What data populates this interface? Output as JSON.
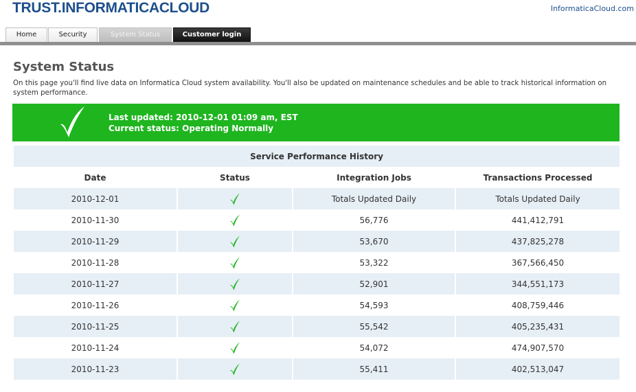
{
  "header": {
    "logo_text": "TRUST.INFORMATICACLOUD",
    "site_link": "InformaticaCloud.com"
  },
  "tabs": [
    {
      "label": "Home"
    },
    {
      "label": "Security"
    },
    {
      "label": "System Status"
    },
    {
      "label": "Customer login"
    }
  ],
  "page": {
    "title": "System Status",
    "intro": "On this page you'll find live data on Informatica Cloud system availability. You'll also be updated on maintenance schedules and be able to track historical information on system performance."
  },
  "banner": {
    "last_updated": "Last updated: 2010-12-01 01:09 am, EST",
    "current_status": "Current status: Operating Normally",
    "icon": "check-icon",
    "color": "#1fb51f"
  },
  "history": {
    "caption": "Service Performance History",
    "columns": [
      "Date",
      "Status",
      "Integration Jobs",
      "Transactions Processed"
    ],
    "rows": [
      {
        "date": "2010-12-01",
        "status": "check-icon",
        "jobs": "Totals Updated Daily",
        "transactions": "Totals Updated Daily"
      },
      {
        "date": "2010-11-30",
        "status": "check-icon",
        "jobs": "56,776",
        "transactions": "441,412,791"
      },
      {
        "date": "2010-11-29",
        "status": "check-icon",
        "jobs": "53,670",
        "transactions": "437,825,278"
      },
      {
        "date": "2010-11-28",
        "status": "check-icon",
        "jobs": "53,322",
        "transactions": "367,566,450"
      },
      {
        "date": "2010-11-27",
        "status": "check-icon",
        "jobs": "52,901",
        "transactions": "344,551,173"
      },
      {
        "date": "2010-11-26",
        "status": "check-icon",
        "jobs": "54,593",
        "transactions": "408,759,446"
      },
      {
        "date": "2010-11-25",
        "status": "check-icon",
        "jobs": "55,542",
        "transactions": "405,235,431"
      },
      {
        "date": "2010-11-24",
        "status": "check-icon",
        "jobs": "54,072",
        "transactions": "474,907,570"
      },
      {
        "date": "2010-11-23",
        "status": "check-icon",
        "jobs": "55,411",
        "transactions": "402,513,047"
      }
    ]
  },
  "colors": {
    "brand": "#1d4f8c",
    "row_tint": "#e6eef6",
    "check": "#1fb51f"
  }
}
